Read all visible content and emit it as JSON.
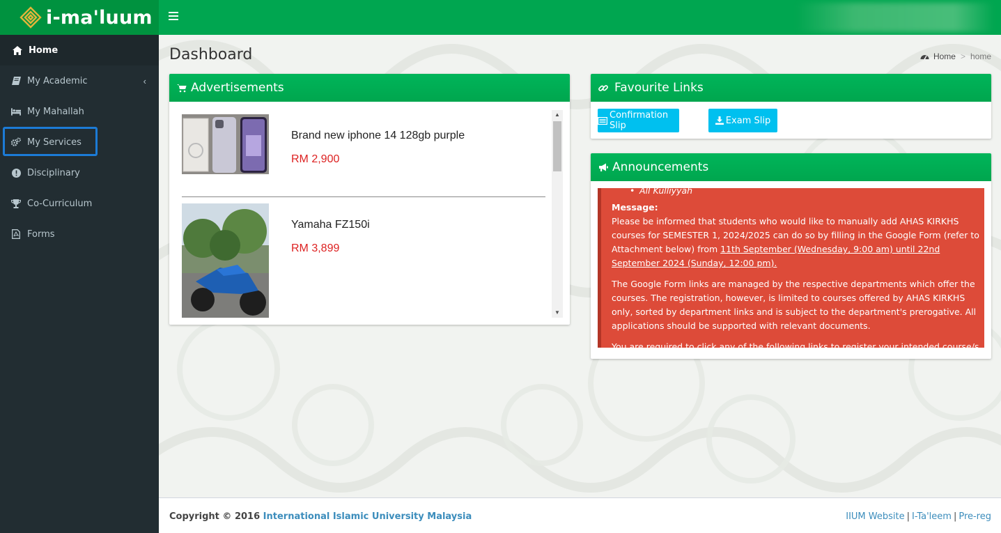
{
  "brand": {
    "name": "i-ma'luum"
  },
  "sidebar": {
    "items": [
      {
        "label": "Home",
        "icon": "home-icon"
      },
      {
        "label": "My Academic",
        "icon": "book-icon"
      },
      {
        "label": "My Mahallah",
        "icon": "bed-icon"
      },
      {
        "label": "My Services",
        "icon": "cogs-icon"
      },
      {
        "label": "Disciplinary",
        "icon": "exclamation-circle-icon"
      },
      {
        "label": "Co-Curriculum",
        "icon": "trophy-icon"
      },
      {
        "label": "Forms",
        "icon": "file-pdf-icon"
      }
    ]
  },
  "page": {
    "title": "Dashboard"
  },
  "breadcrumb": {
    "home": "Home",
    "current": "home"
  },
  "ads": {
    "title": "Advertisements",
    "items": [
      {
        "title": "Brand new iphone 14 128gb purple",
        "price": "RM 2,900"
      },
      {
        "title": "Yamaha FZ150i",
        "price": "RM 3,899"
      }
    ]
  },
  "favourites": {
    "title": "Favourite Links",
    "buttons": [
      {
        "label": "Confirmation Slip"
      },
      {
        "label": "Exam Slip"
      }
    ]
  },
  "announcements": {
    "title": "Announcements",
    "bullet": "All Kulliyyah",
    "message_label": "Message:",
    "para1_a": "Please be informed that students who would like to manually add AHAS KIRKHS courses for SEMESTER 1, 2024/2025 can do so by filling in the Google Form (refer to Attachment below) from ",
    "para1_u": "11th September (Wednesday, 9:00 am) until 22nd September 2024 (Sunday, 12:00 pm).",
    "para2": "The Google Form links are managed by the respective departments which offer the courses. The registration, however, is limited to courses offered by AHAS KIRKHS only, sorted by department links and is subject to the department's prerogative. All applications should be supported with relevant documents.",
    "para3": "You are required to click any of the following links to register your intended course/s (e.g."
  },
  "footer": {
    "copyright": "Copyright © 2016",
    "org": "International Islamic University Malaysia",
    "links": [
      "IIUM Website",
      "I-Ta'leem",
      "Pre-reg"
    ]
  },
  "colors": {
    "brand_green": "#00a650",
    "sidebar_bg": "#222d32",
    "info_button": "#00c0ef",
    "announcement_bg": "#dd4b39",
    "price_red": "#dd2222"
  }
}
